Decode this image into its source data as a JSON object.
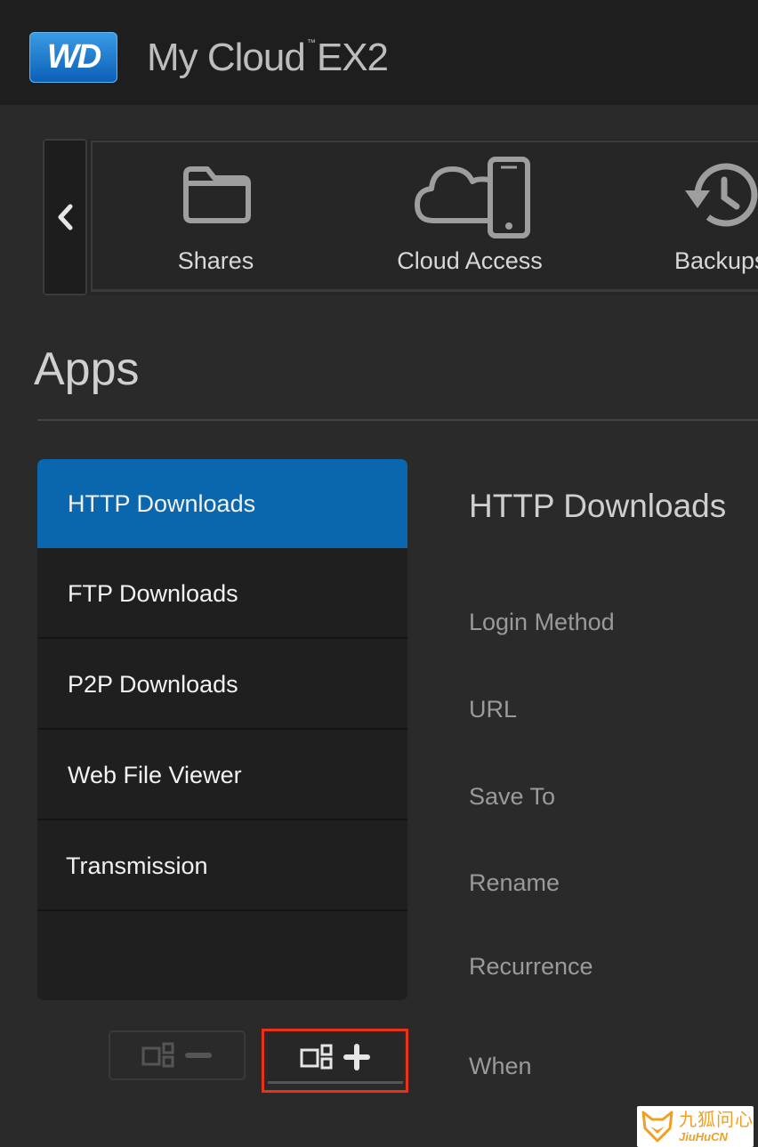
{
  "header": {
    "logo_text": "WD",
    "brand": "My Cloud",
    "trademark": "™",
    "model": "EX2"
  },
  "nav": {
    "items": [
      {
        "label": "Shares",
        "icon": "folder-icon"
      },
      {
        "label": "Cloud Access",
        "icon": "cloud-phone-icon"
      },
      {
        "label": "Backups",
        "icon": "history-icon"
      }
    ]
  },
  "page": {
    "title": "Apps"
  },
  "apps": {
    "items": [
      {
        "label": "HTTP Downloads",
        "active": true
      },
      {
        "label": "FTP Downloads",
        "active": false
      },
      {
        "label": "P2P Downloads",
        "active": false
      },
      {
        "label": "Web File Viewer",
        "active": false
      },
      {
        "label": "Transmission",
        "active": false
      }
    ]
  },
  "panel": {
    "title": "HTTP Downloads",
    "fields": [
      "Login Method",
      "URL",
      "Save To",
      "Rename",
      "Recurrence",
      "When"
    ]
  },
  "watermark": {
    "cn": "九狐问心",
    "en": "JiuHuCN"
  },
  "colors": {
    "active": "#0a66ad",
    "highlight": "#e8321a",
    "header_bg": "#1e1e1e"
  }
}
